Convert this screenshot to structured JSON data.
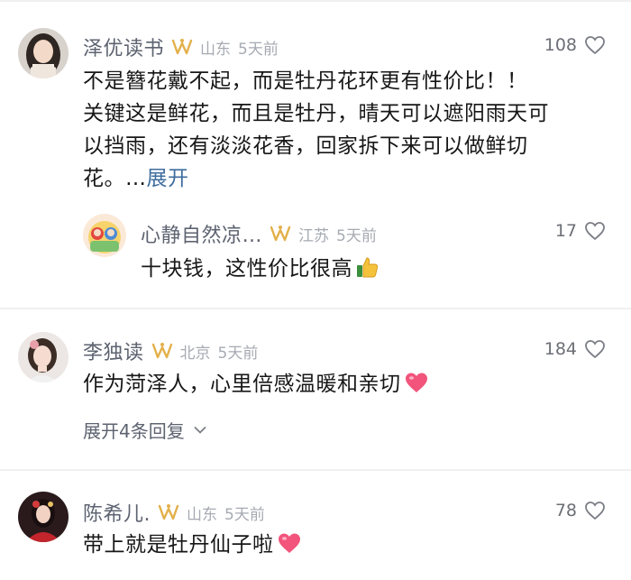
{
  "colors": {
    "name": "#5d6370",
    "location": "#a6aab2",
    "badge": "#e3b04b",
    "link": "#3f6d9e",
    "heart_fill": "#f2547b"
  },
  "comments": [
    {
      "username": "泽优读书",
      "location": "山东",
      "time": "5天前",
      "likes": "108",
      "lines": [
        "不是簪花戴不起，而是牡丹花环更有性价比！！",
        "关键这是鲜花，而且是牡丹，晴天可以遮阳雨天可",
        "以挡雨，还有淡淡花香，回家拆下来可以做鲜切",
        "花。…"
      ],
      "expand_label": "展开",
      "reply": {
        "username": "心静自然凉…",
        "location": "江苏",
        "time": "5天前",
        "likes": "17",
        "text": "十块钱，这性价比很高",
        "emoji": "thumbs-up-emoji"
      }
    },
    {
      "username": "李独读",
      "location": "北京",
      "time": "5天前",
      "likes": "184",
      "text": "作为菏泽人，心里倍感温暖和亲切",
      "emoji": "pink-heart-emoji",
      "expand_replies": "展开4条回复"
    },
    {
      "username": "陈希儿.",
      "location": "山东",
      "time": "5天前",
      "likes": "78",
      "text": "带上就是牡丹仙子啦",
      "emoji": "pink-heart-emoji"
    }
  ]
}
